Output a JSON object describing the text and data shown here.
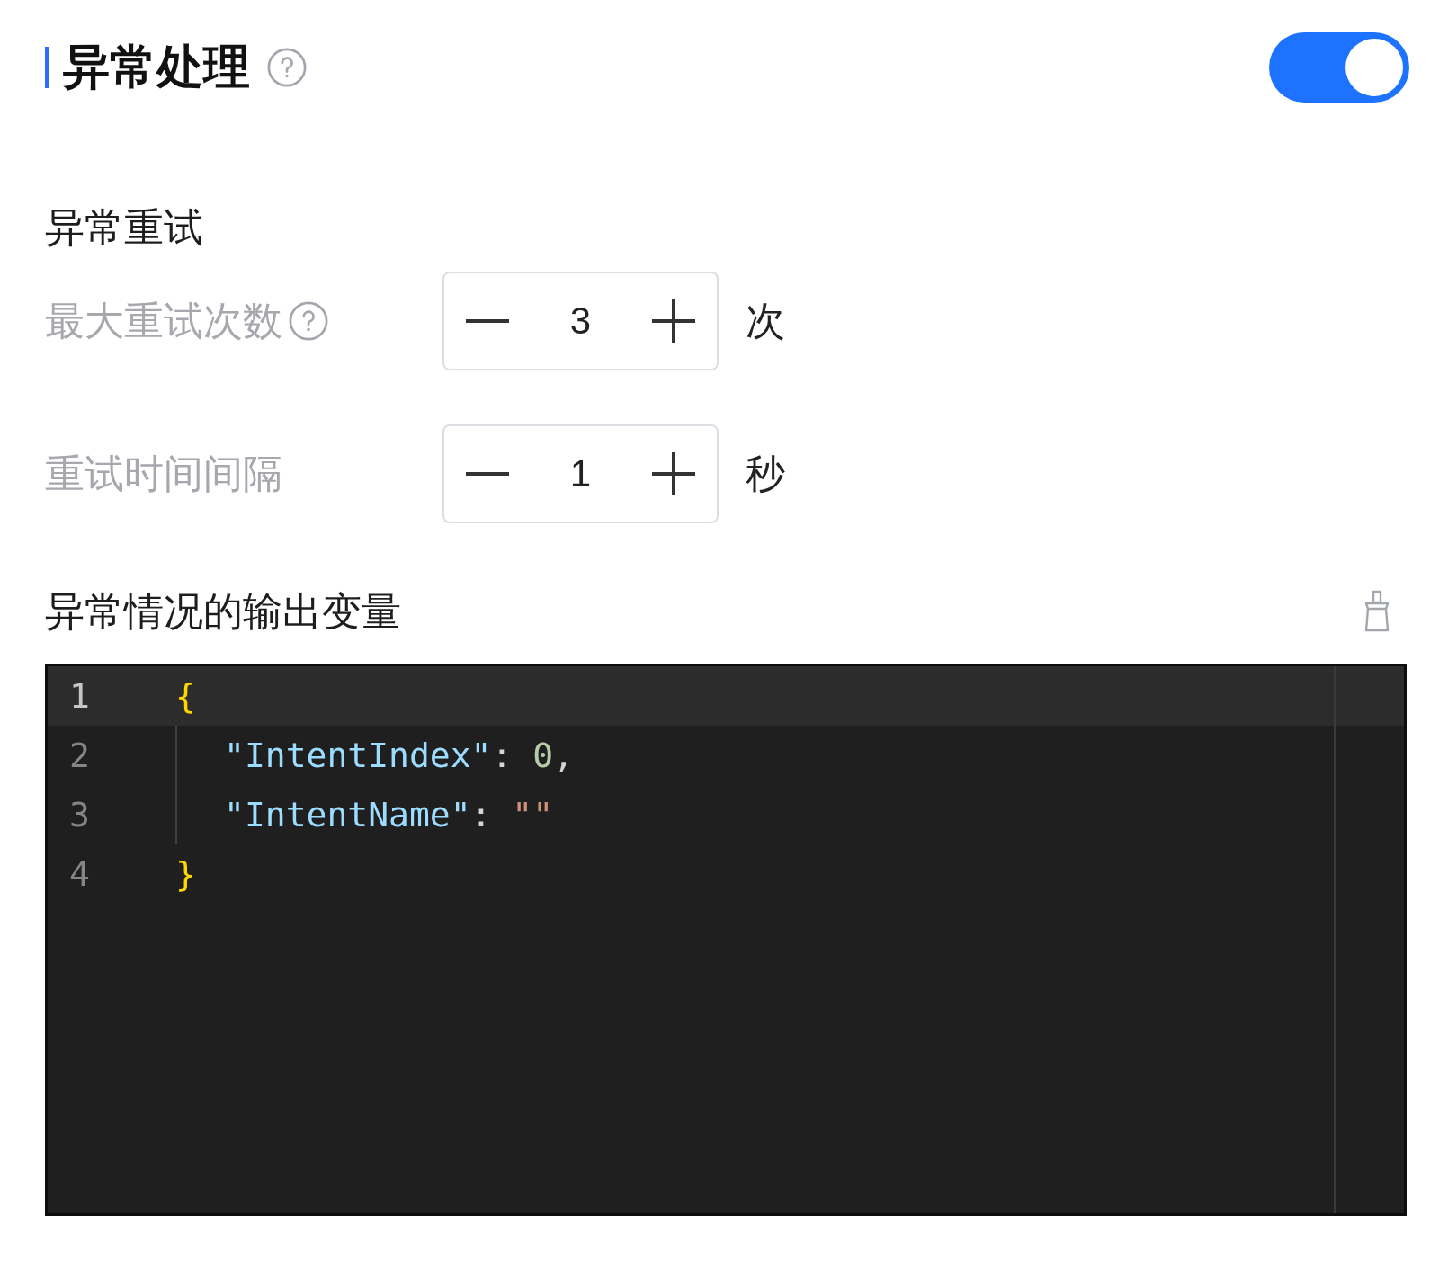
{
  "header": {
    "title": "异常处理",
    "help": true,
    "toggle": {
      "on": true
    }
  },
  "retry": {
    "title": "异常重试",
    "fields": [
      {
        "label": "最大重试次数",
        "help": true,
        "value": "3",
        "unit": "次"
      },
      {
        "label": "重试时间间隔",
        "help": false,
        "value": "1",
        "unit": "秒"
      }
    ]
  },
  "output": {
    "title": "异常情况的输出变量",
    "editor": {
      "lines": [
        {
          "number": "1",
          "active": true,
          "indented": false,
          "tokens": [
            {
              "kind": "brace",
              "text": "{"
            }
          ]
        },
        {
          "number": "2",
          "active": false,
          "indented": true,
          "tokens": [
            {
              "kind": "key",
              "text": "\"IntentIndex\""
            },
            {
              "kind": "punct",
              "text": ": "
            },
            {
              "kind": "number",
              "text": "0"
            },
            {
              "kind": "punct",
              "text": ","
            }
          ]
        },
        {
          "number": "3",
          "active": false,
          "indented": true,
          "tokens": [
            {
              "kind": "key",
              "text": "\"IntentName\""
            },
            {
              "kind": "punct",
              "text": ": "
            },
            {
              "kind": "string",
              "text": "\"\""
            }
          ]
        },
        {
          "number": "4",
          "active": false,
          "indented": false,
          "tokens": [
            {
              "kind": "brace",
              "text": "}"
            }
          ]
        }
      ]
    }
  }
}
